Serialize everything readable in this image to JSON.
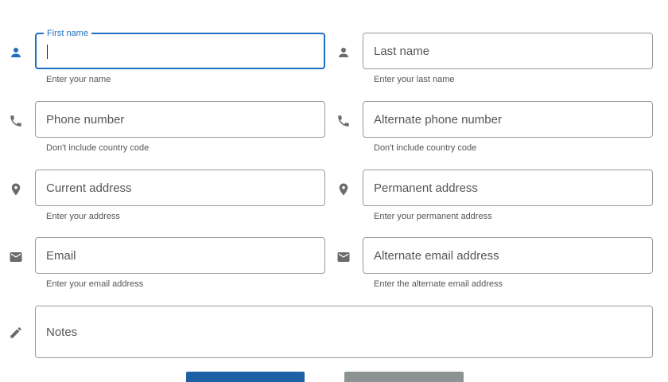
{
  "form": {
    "first_name": {
      "label": "First name",
      "value": "",
      "helper": "Enter your name",
      "icon": "person-icon"
    },
    "last_name": {
      "placeholder": "Last name",
      "helper": "Enter your last name",
      "icon": "person-icon"
    },
    "phone": {
      "placeholder": "Phone number",
      "helper": "Don't include country code",
      "icon": "phone-icon"
    },
    "alt_phone": {
      "placeholder": "Alternate phone number",
      "helper": "Don't include country code",
      "icon": "phone-icon"
    },
    "current_address": {
      "placeholder": "Current address",
      "helper": "Enter your address",
      "icon": "location-pin-icon"
    },
    "permanent_address": {
      "placeholder": "Permanent address",
      "helper": "Enter your permanent address",
      "icon": "location-pin-icon"
    },
    "email": {
      "placeholder": "Email",
      "helper": "Enter your email address",
      "icon": "mail-icon"
    },
    "alt_email": {
      "placeholder": "Alternate email address",
      "helper": "Enter the alternate email address",
      "icon": "mail-icon"
    },
    "notes": {
      "placeholder": "Notes",
      "icon": "pencil-icon"
    }
  },
  "colors": {
    "accent": "#1f6fbf",
    "primary_button": "#1f5fa6",
    "secondary_button": "#8c9393",
    "icon_active": "#1f6fbf",
    "icon_inactive": "#6b6b6b"
  }
}
